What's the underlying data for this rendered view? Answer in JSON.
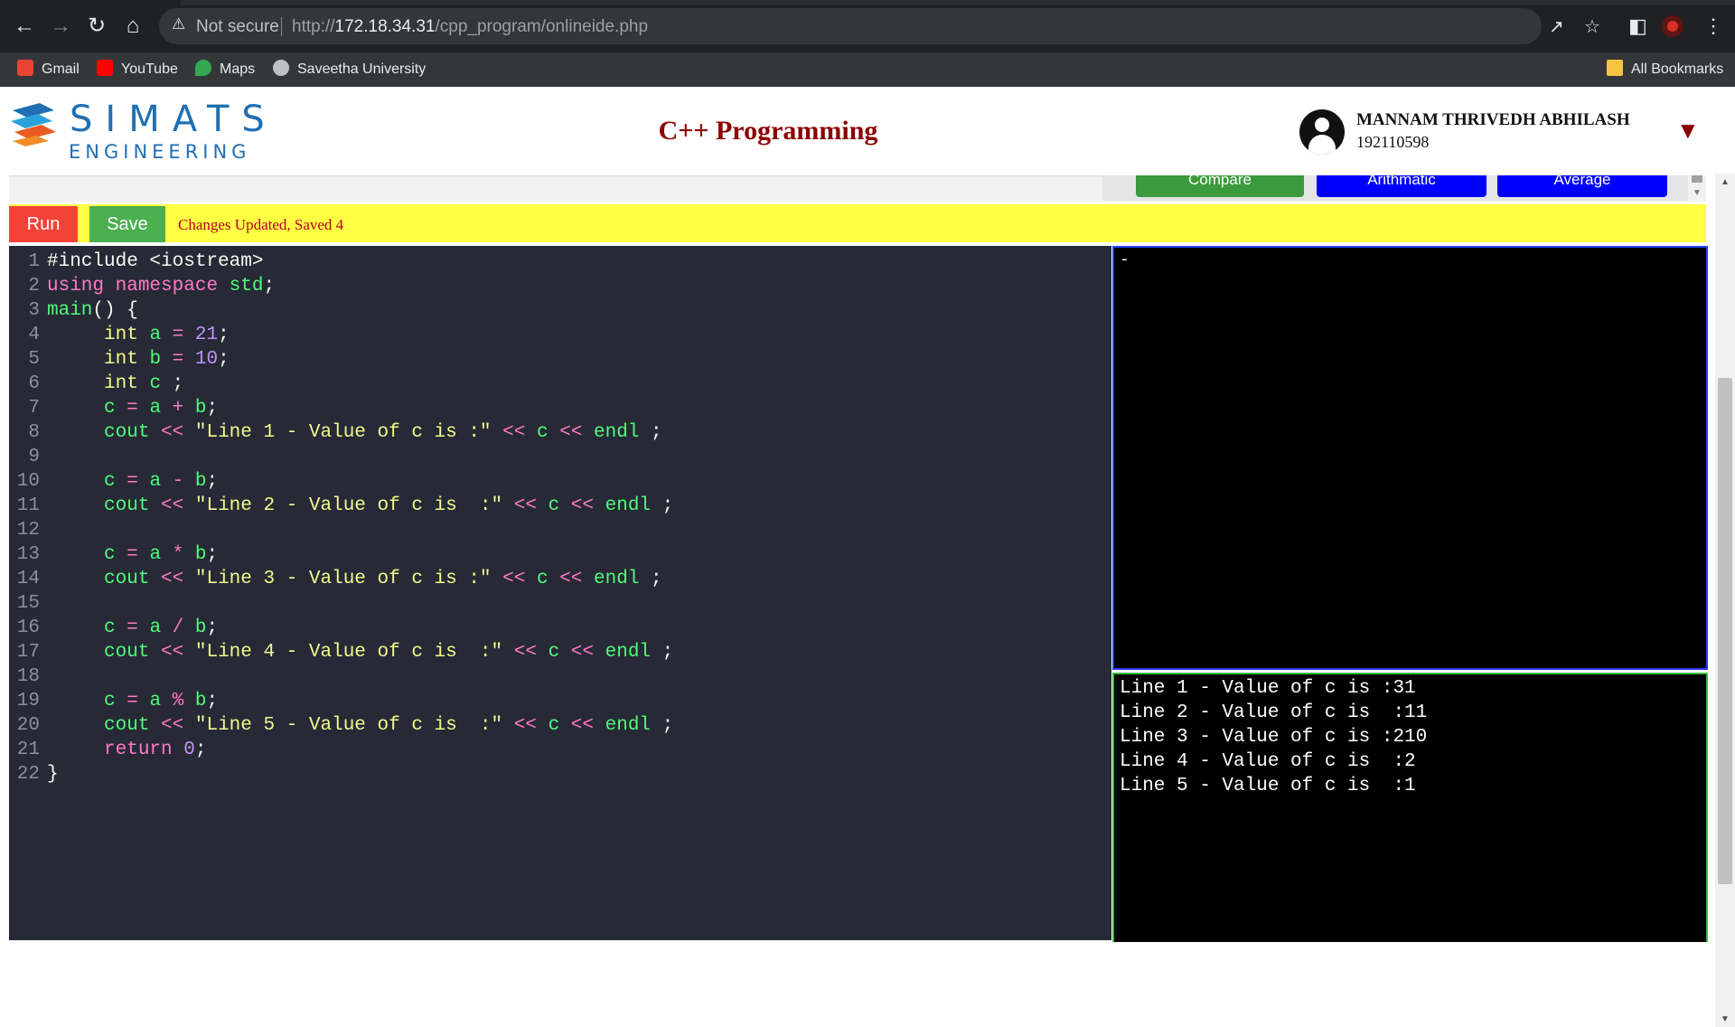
{
  "browser": {
    "security_label": "Not secure",
    "url_prefix": "http://",
    "url_host": "172.18.34.31",
    "url_path": "/cpp_program/onlineide.php",
    "bookmarks": [
      {
        "label": "Gmail",
        "icon": "gmail-icon",
        "color": "#ea4335"
      },
      {
        "label": "YouTube",
        "icon": "youtube-icon",
        "color": "#ff0000"
      },
      {
        "label": "Maps",
        "icon": "maps-icon",
        "color": "#34a853"
      },
      {
        "label": "Saveetha University",
        "icon": "globe-icon",
        "color": "#bdc1c6"
      }
    ],
    "all_bookmarks_label": "All Bookmarks"
  },
  "header": {
    "logo_line1": "SIMATS",
    "logo_line2": "ENGINEERING",
    "title": "C++ Programming",
    "user_name": "MANNAM THRIVEDH ABHILASH",
    "user_id": "192110598"
  },
  "quick_buttons": [
    {
      "label": "Compare",
      "color": "#3b9a3b"
    },
    {
      "label": "Arithmatic",
      "color": "#0000ff"
    },
    {
      "label": "Average",
      "color": "#0000ff"
    }
  ],
  "actions": {
    "run_label": "Run",
    "save_label": "Save",
    "status_text": "Changes Updated, Saved 4"
  },
  "editor": {
    "lines": [
      "#include <iostream>",
      "using namespace std;",
      "main() {",
      "     int a = 21;",
      "     int b = 10;",
      "     int c ;",
      "     c = a + b;",
      "     cout << \"Line 1 - Value of c is :\" << c << endl ;",
      "",
      "     c = a - b;",
      "     cout << \"Line 2 - Value of c is  :\" << c << endl ;",
      "",
      "     c = a * b;",
      "     cout << \"Line 3 - Value of c is :\" << c << endl ;",
      "",
      "     c = a / b;",
      "     cout << \"Line 4 - Value of c is  :\" << c << endl ;",
      "",
      "     c = a % b;",
      "     cout << \"Line 5 - Value of c is  :\" << c << endl ;",
      "     return 0;",
      "}"
    ]
  },
  "input_console": {
    "content": "-"
  },
  "output_console": {
    "lines": [
      "Line 1 - Value of c is :31",
      "Line 2 - Value of c is  :11",
      "Line 3 - Value of c is :210",
      "Line 4 - Value of c is  :2",
      "Line 5 - Value of c is  :1"
    ]
  }
}
